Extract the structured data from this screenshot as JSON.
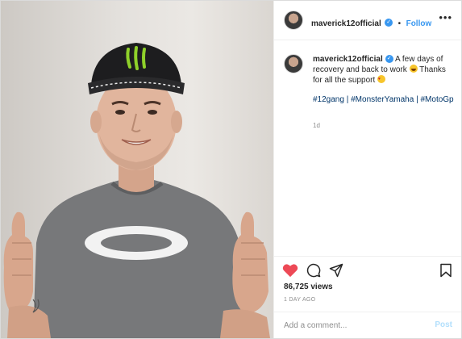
{
  "post": {
    "username": "maverick12official",
    "follow_label": "Follow",
    "dot": "•",
    "more_label": "•••",
    "caption_text": "A few days of recovery and back to work",
    "caption_text_2": "Thanks for all the support",
    "hashtags": [
      "#12gang",
      "#MonsterYamaha",
      "#MotoGp"
    ],
    "hashtag_sep": "|",
    "time_ago": "1d",
    "views": "86,725 views",
    "date_label": "1 DAY AGO",
    "comment_placeholder": "Add a comment...",
    "post_label": "Post"
  },
  "icons": [
    "heart-icon",
    "comment-icon",
    "share-icon",
    "bookmark-icon",
    "verified-icon",
    "more-icon"
  ],
  "colors": {
    "like": "#ed4956",
    "link": "#3897f0",
    "hashtag": "#003569",
    "muted": "#8e8e8e",
    "post_disabled": "#b2dffc",
    "shirt": "#77787a",
    "cap": "#1d1d1f",
    "cap_logo": "#8fd12a"
  }
}
